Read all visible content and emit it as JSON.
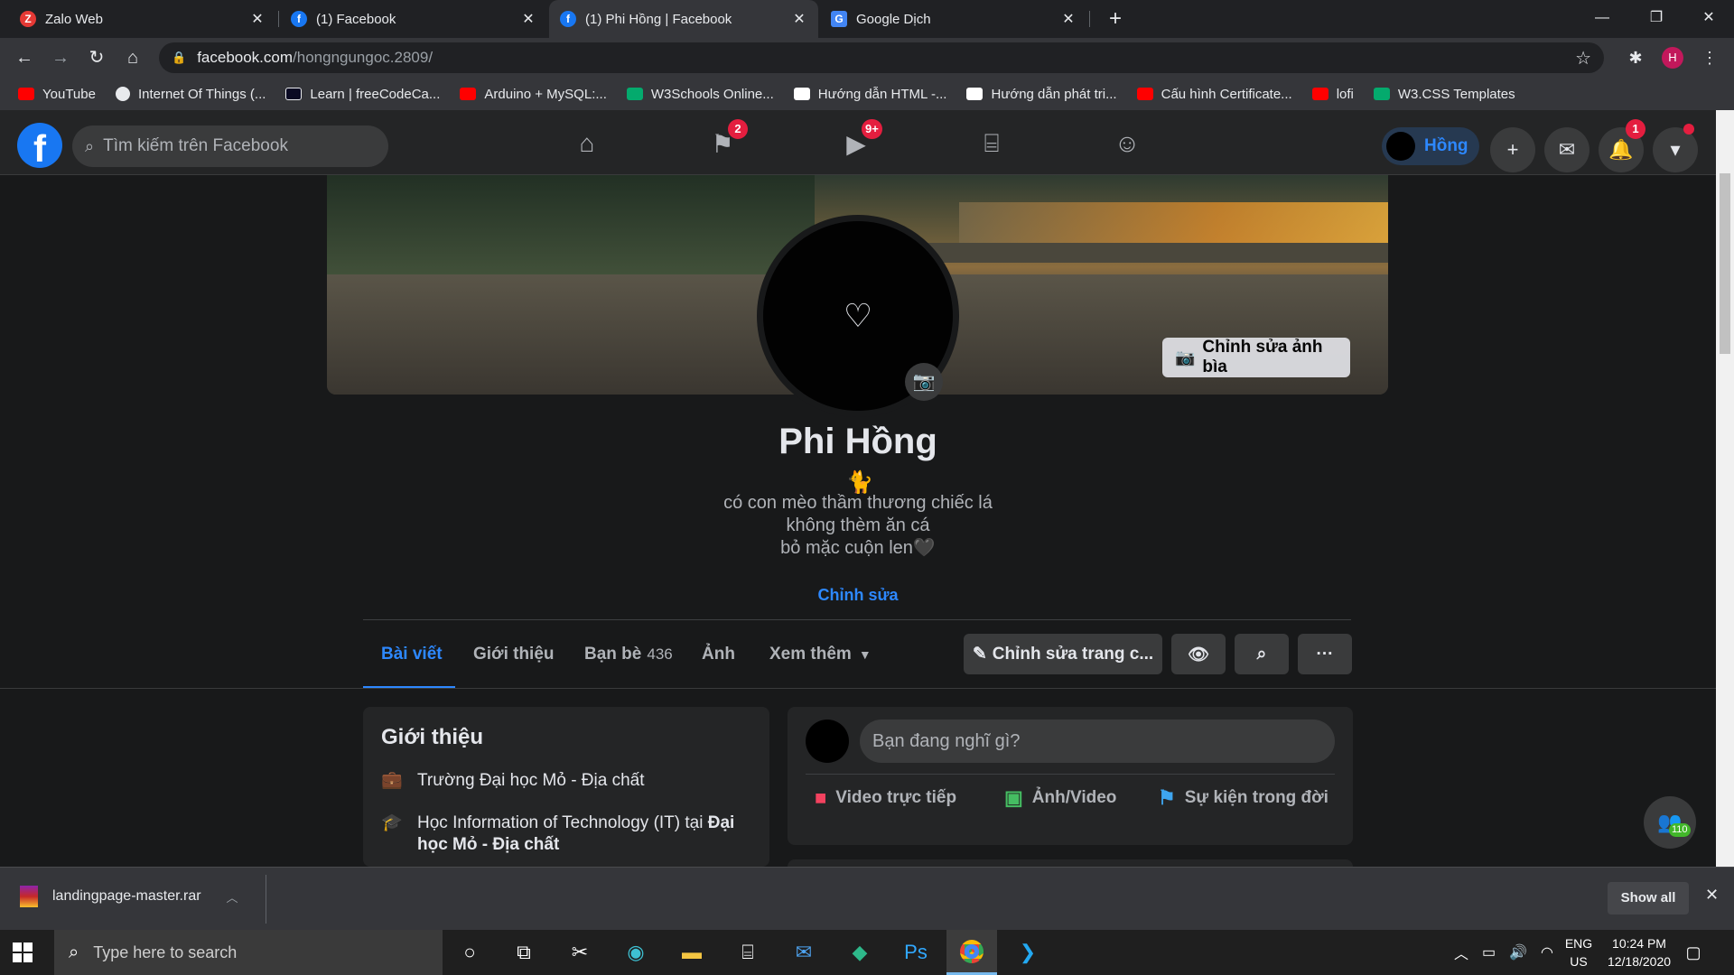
{
  "browser": {
    "tabs": [
      {
        "title": "Zalo Web"
      },
      {
        "title": "(1) Facebook"
      },
      {
        "title": "(1) Phi Hồng | Facebook"
      },
      {
        "title": "Google Dịch"
      }
    ],
    "url_host": "facebook.com",
    "url_path": "/hongngungoc.2809/",
    "profile_initial": "H",
    "bookmarks": [
      {
        "label": "YouTube"
      },
      {
        "label": "Internet Of Things (..."
      },
      {
        "label": "Learn | freeCodeCa..."
      },
      {
        "label": "Arduino + MySQL:..."
      },
      {
        "label": "W3Schools Online..."
      },
      {
        "label": "Hướng dẫn HTML -..."
      },
      {
        "label": "Hướng dẫn phát tri..."
      },
      {
        "label": "Cấu hình Certificate..."
      },
      {
        "label": "lofi"
      },
      {
        "label": "W3.CSS Templates"
      }
    ],
    "colors": {
      "youtube": "#ff0000",
      "w3": "#04aa6d",
      "w3r": "#ffffff"
    }
  },
  "fb": {
    "logo": "f",
    "search_placeholder": "Tìm kiếm trên Facebook",
    "nav_badges": {
      "pages": "2",
      "watch": "9+"
    },
    "user_pill": "Hồng",
    "notif_badge": "1",
    "accent": "#2d88ff"
  },
  "profile": {
    "edit_cover": "Chỉnh sửa ảnh bìa",
    "name": "Phi Hồng",
    "emoji": "🐈",
    "bio_lines": [
      "có con mèo thầm thương chiếc lá",
      "không thèm ăn cá",
      "bỏ mặc cuộn len🖤"
    ],
    "edit_bio": "Chỉnh sửa",
    "tabs": [
      {
        "label": "Bài viết"
      },
      {
        "label": "Giới thiệu"
      },
      {
        "label": "Bạn bè",
        "count": "436"
      },
      {
        "label": "Ảnh"
      },
      {
        "label": "Xem thêm"
      }
    ],
    "edit_profile": "Chỉnh sửa trang c...",
    "more": "···"
  },
  "intro": {
    "title": "Giới thiệu",
    "work": "Trường Đại học Mỏ - Địa chất",
    "study_prefix": "Học Information of Technology (IT) tại ",
    "study_school_1": "Đại",
    "study_school_2": "học Mỏ - Địa chất"
  },
  "composer": {
    "placeholder": "Bạn đang nghĩ gì?",
    "actions": [
      {
        "label": "Video trực tiếp"
      },
      {
        "label": "Ảnh/Video"
      },
      {
        "label": "Sự kiện trong đời"
      }
    ]
  },
  "friends_fab_count": "110",
  "download": {
    "filename": "landingpage-master.rar",
    "show_all": "Show all"
  },
  "taskbar": {
    "search_placeholder": "Type here to search",
    "lang_1": "ENG",
    "lang_2": "US",
    "time": "10:24 PM",
    "date": "12/18/2020"
  }
}
